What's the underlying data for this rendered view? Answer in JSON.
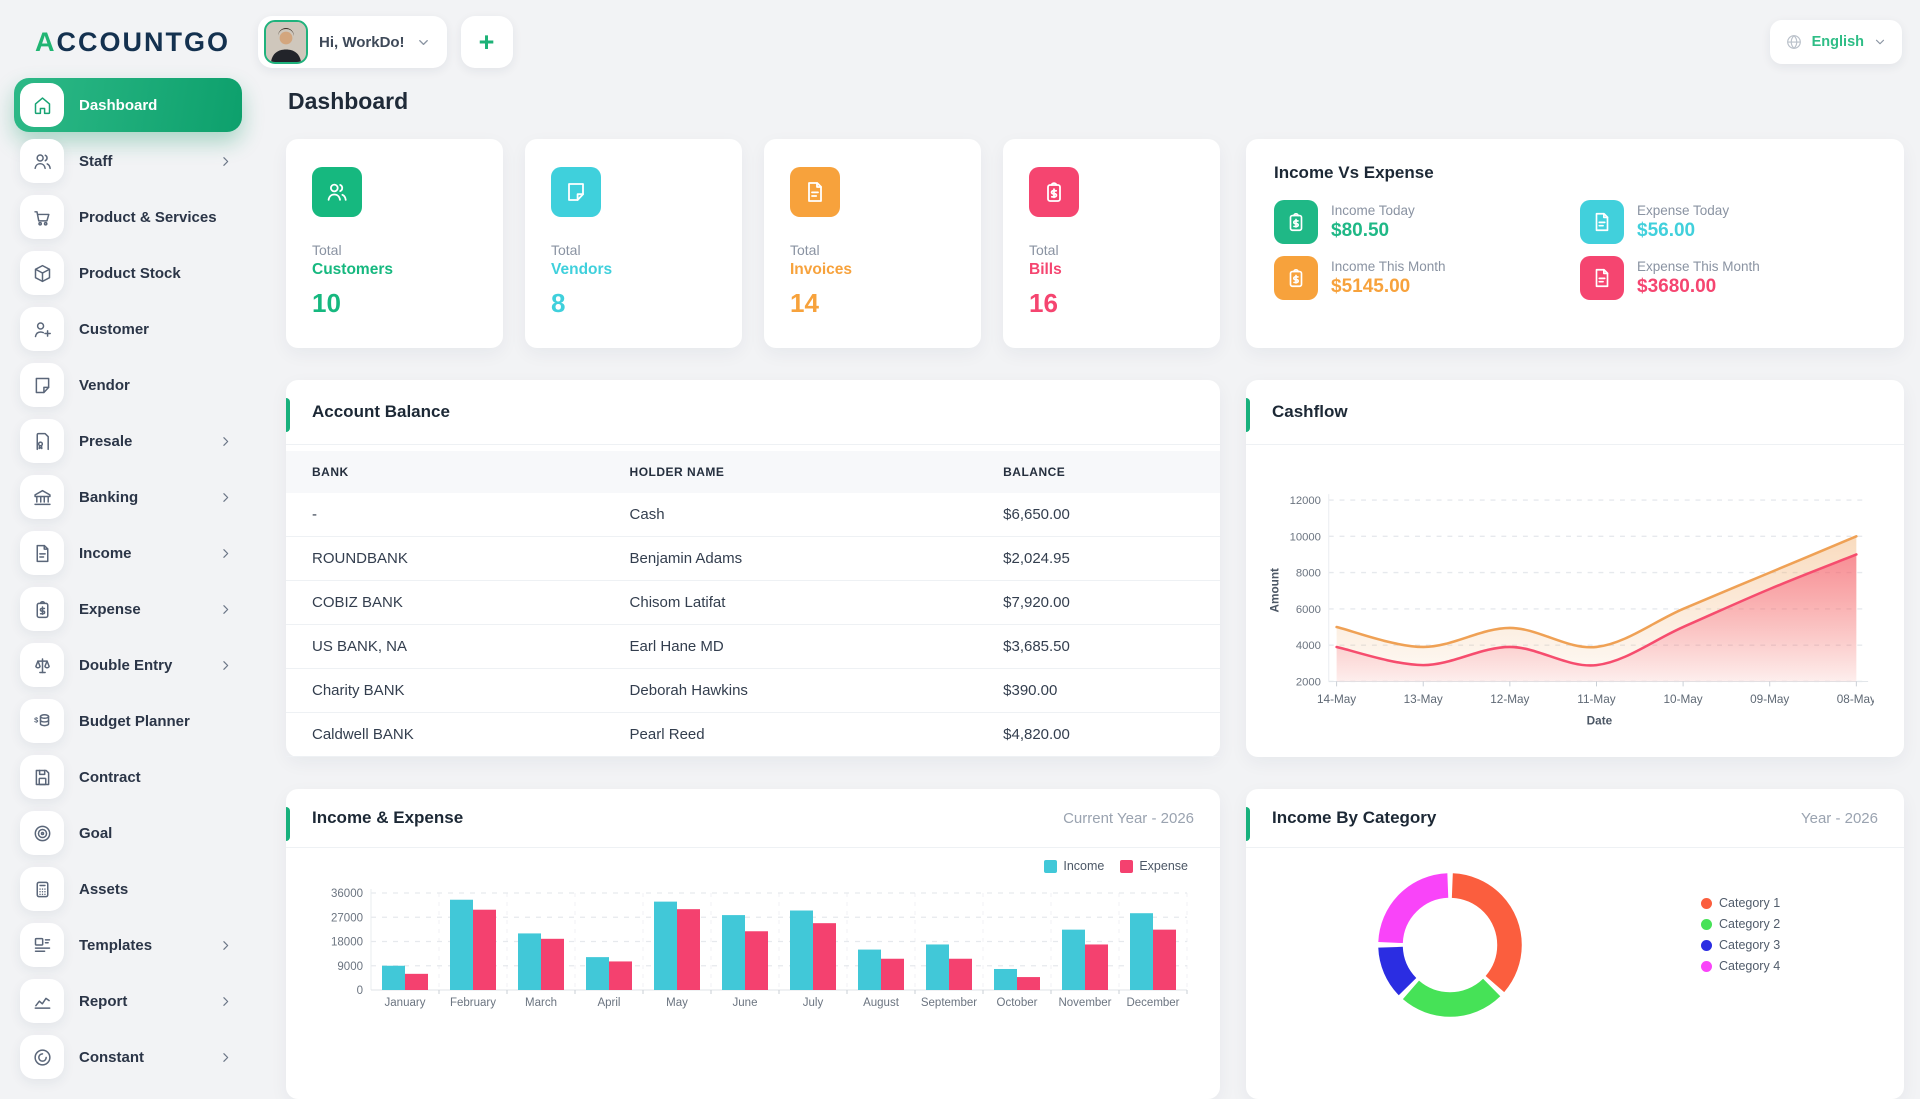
{
  "brand": {
    "logo_accent": "A",
    "logo_rest": "CCOUNTGO"
  },
  "header": {
    "greeting": "Hi, WorkDo!",
    "add_button": "+",
    "language": "English",
    "accent_color": "#21b573"
  },
  "page": {
    "title": "Dashboard"
  },
  "sidebar": {
    "items": [
      {
        "label": "Dashboard",
        "icon": "home-icon",
        "active": true,
        "chevron": false
      },
      {
        "label": "Staff",
        "icon": "users-icon",
        "active": false,
        "chevron": true
      },
      {
        "label": "Product & Services",
        "icon": "cart-icon",
        "active": false,
        "chevron": false
      },
      {
        "label": "Product Stock",
        "icon": "box-icon",
        "active": false,
        "chevron": false
      },
      {
        "label": "Customer",
        "icon": "user-plus-icon",
        "active": false,
        "chevron": false
      },
      {
        "label": "Vendor",
        "icon": "note-icon",
        "active": false,
        "chevron": false
      },
      {
        "label": "Presale",
        "icon": "file-badge-icon",
        "active": false,
        "chevron": true
      },
      {
        "label": "Banking",
        "icon": "bank-icon",
        "active": false,
        "chevron": true
      },
      {
        "label": "Income",
        "icon": "file-text-icon",
        "active": false,
        "chevron": true
      },
      {
        "label": "Expense",
        "icon": "clipboard-dollar-icon",
        "active": false,
        "chevron": true
      },
      {
        "label": "Double Entry",
        "icon": "scale-icon",
        "active": false,
        "chevron": true
      },
      {
        "label": "Budget Planner",
        "icon": "coins-icon",
        "active": false,
        "chevron": false
      },
      {
        "label": "Contract",
        "icon": "save-icon",
        "active": false,
        "chevron": false
      },
      {
        "label": "Goal",
        "icon": "target-icon",
        "active": false,
        "chevron": false
      },
      {
        "label": "Assets",
        "icon": "calculator-icon",
        "active": false,
        "chevron": false
      },
      {
        "label": "Templates",
        "icon": "layout-icon",
        "active": false,
        "chevron": true
      },
      {
        "label": "Report",
        "icon": "chart-icon",
        "active": false,
        "chevron": true
      },
      {
        "label": "Constant",
        "icon": "disc-icon",
        "active": false,
        "chevron": true
      }
    ]
  },
  "stats": {
    "cards": [
      {
        "prefix": "Total",
        "label": "Customers",
        "value": "10",
        "color": "#16b87f",
        "icon": "users-icon"
      },
      {
        "prefix": "Total",
        "label": "Vendors",
        "value": "8",
        "color": "#3fd0dc",
        "icon": "note-icon"
      },
      {
        "prefix": "Total",
        "label": "Invoices",
        "value": "14",
        "color": "#f7a23c",
        "icon": "file-text-icon"
      },
      {
        "prefix": "Total",
        "label": "Bills",
        "value": "16",
        "color": "#f54570",
        "icon": "clipboard-dollar-icon"
      }
    ]
  },
  "income_vs_expense": {
    "title": "Income Vs Expense",
    "metrics": [
      {
        "label": "Income Today",
        "value": "$80.50",
        "color": "#1fb886",
        "icon": "clipboard-dollar-icon"
      },
      {
        "label": "Expense Today",
        "value": "$56.00",
        "color": "#41d0dc",
        "icon": "file-text-icon"
      },
      {
        "label": "Income This Month",
        "value": "$5145.00",
        "color": "#f7a23c",
        "icon": "clipboard-dollar-icon"
      },
      {
        "label": "Expense This Month",
        "value": "$3680.00",
        "color": "#f54570",
        "icon": "file-text-icon"
      }
    ]
  },
  "account_balance": {
    "title": "Account Balance",
    "columns": [
      "BANK",
      "HOLDER NAME",
      "BALANCE"
    ],
    "rows": [
      [
        "-",
        "Cash",
        "$6,650.00"
      ],
      [
        "ROUNDBANK",
        "Benjamin Adams",
        "$2,024.95"
      ],
      [
        "COBIZ BANK",
        "Chisom Latifat",
        "$7,920.00"
      ],
      [
        "US BANK, NA",
        "Earl Hane MD",
        "$3,685.50"
      ],
      [
        "Charity BANK",
        "Deborah Hawkins",
        "$390.00"
      ],
      [
        "Caldwell BANK",
        "Pearl Reed",
        "$4,820.00"
      ]
    ]
  },
  "chart_data": [
    {
      "id": "cashflow",
      "type": "area",
      "title": "Cashflow",
      "xlabel": "Date",
      "ylabel": "Amount",
      "x": [
        "14-May",
        "13-May",
        "12-May",
        "11-May",
        "10-May",
        "09-May",
        "08-May"
      ],
      "yticks": [
        2000,
        4000,
        6000,
        8000,
        10000,
        12000
      ],
      "ylim": [
        2000,
        12000
      ],
      "grid": "dashed-horizontal",
      "series": [
        {
          "name": "upper-line",
          "color": "#efa155",
          "values": [
            5000,
            3900,
            4950,
            3900,
            6000,
            8000,
            10000
          ]
        },
        {
          "name": "lower-line",
          "color": "#f64d6e",
          "values": [
            3900,
            2900,
            3900,
            2900,
            5000,
            7100,
            9000
          ]
        }
      ]
    },
    {
      "id": "income_expense",
      "type": "bar",
      "title": "Income & Expense",
      "subtitle": "Current Year - 2026",
      "categories": [
        "January",
        "February",
        "March",
        "April",
        "May",
        "June",
        "July",
        "August",
        "September",
        "October",
        "November",
        "December"
      ],
      "yticks": [
        0,
        9000,
        18000,
        27000,
        36000
      ],
      "ylim": [
        0,
        36000
      ],
      "legend_position": "top-right",
      "series": [
        {
          "name": "Income",
          "color": "#41c8d8",
          "values": [
            9000,
            33500,
            21000,
            12200,
            32800,
            27800,
            29500,
            15000,
            16900,
            7800,
            22400,
            28500
          ]
        },
        {
          "name": "Expense",
          "color": "#f4416f",
          "values": [
            6000,
            29800,
            19000,
            10600,
            30000,
            21800,
            24800,
            11600,
            11600,
            4800,
            16900,
            22400
          ]
        }
      ]
    },
    {
      "id": "income_by_category",
      "type": "donut",
      "title": "Income By Category",
      "subtitle": "Year - 2026",
      "slices": [
        {
          "label": "Category 1",
          "color": "#fb5e3e",
          "value": 37
        },
        {
          "label": "Category 2",
          "color": "#46e257",
          "value": 25
        },
        {
          "label": "Category 3",
          "color": "#2b2de2",
          "value": 13
        },
        {
          "label": "Category 4",
          "color": "#f944f9",
          "value": 25
        }
      ]
    }
  ]
}
